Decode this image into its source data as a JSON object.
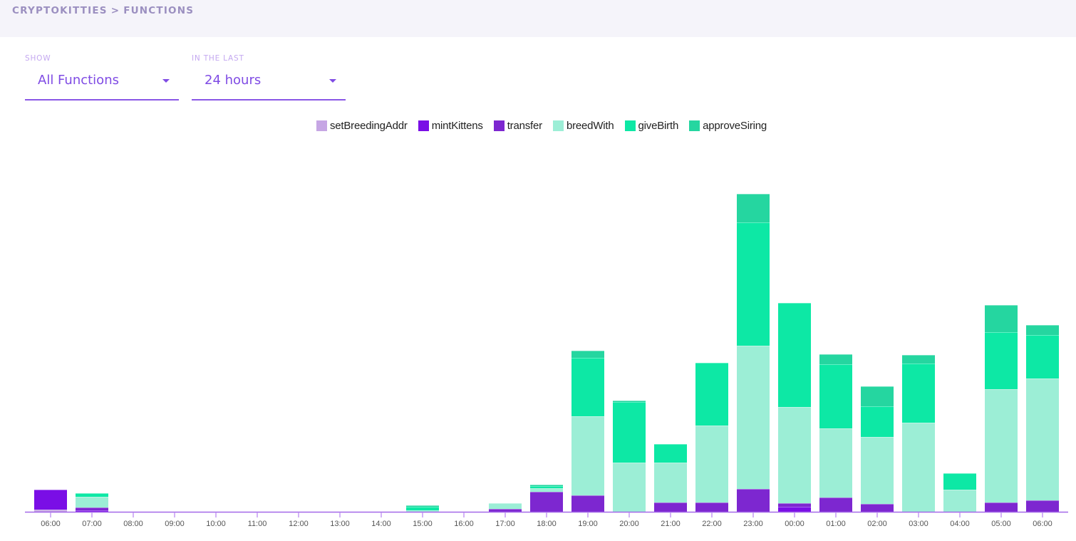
{
  "header": {
    "breadcrumb": {
      "parent": "CRYPTOKITTIES",
      "separator": ">",
      "current": "FUNCTIONS"
    }
  },
  "filters": {
    "show": {
      "label": "SHOW",
      "value": "All Functions",
      "icon": "caret-down-icon"
    },
    "range": {
      "label": "IN THE LAST",
      "value": "24 hours",
      "icon": "caret-down-icon"
    }
  },
  "theme": {
    "accent": "#7f4be4",
    "header_bg": "#f5f4fa",
    "axis_color": "#a468e8",
    "tick_color": "#d3b3f6"
  },
  "chart_data": {
    "type": "bar",
    "stacked": true,
    "title": "",
    "xlabel": "",
    "ylabel": "",
    "y_axis_visible": false,
    "grid": false,
    "legend": "top-center",
    "ylim": [
      0,
      460
    ],
    "categories": [
      "06:00",
      "07:00",
      "08:00",
      "09:00",
      "10:00",
      "11:00",
      "12:00",
      "13:00",
      "14:00",
      "15:00",
      "16:00",
      "17:00",
      "18:00",
      "19:00",
      "20:00",
      "21:00",
      "22:00",
      "23:00",
      "00:00",
      "01:00",
      "02:00",
      "03:00",
      "04:00",
      "05:00",
      "06:00"
    ],
    "series": [
      {
        "name": "setBreedingAddr",
        "color": "#c6a6e4",
        "values": [
          3,
          0,
          0,
          0,
          0,
          0,
          0,
          0,
          0,
          0,
          0,
          0,
          0,
          0,
          0,
          0,
          0,
          0,
          0,
          0,
          0,
          0,
          0,
          0,
          0
        ]
      },
      {
        "name": "mintKittens",
        "color": "#7a0ee6",
        "values": [
          28,
          2,
          0,
          0,
          0,
          0,
          0,
          0,
          0,
          0,
          0,
          0,
          0,
          0,
          0,
          0,
          0,
          0,
          7,
          0,
          0,
          0,
          0,
          0,
          0
        ]
      },
      {
        "name": "transfer",
        "color": "#7d27d0",
        "values": [
          0,
          4,
          0,
          0,
          0,
          0,
          0,
          0,
          0,
          0,
          0,
          4,
          28,
          23,
          0,
          13,
          13,
          32,
          5,
          20,
          11,
          0,
          0,
          13,
          16
        ]
      },
      {
        "name": "breedWith",
        "color": "#9ceed6",
        "values": [
          0,
          15,
          0,
          0,
          0,
          0,
          0,
          0,
          0,
          2,
          0,
          8,
          5,
          111,
          69,
          56,
          108,
          201,
          135,
          97,
          94,
          125,
          31,
          159,
          171
        ]
      },
      {
        "name": "giveBirth",
        "color": "#0de8a5",
        "values": [
          0,
          5,
          0,
          0,
          0,
          0,
          0,
          0,
          0,
          5,
          0,
          0,
          3,
          82,
          85,
          26,
          88,
          173,
          146,
          90,
          43,
          83,
          23,
          80,
          61
        ]
      },
      {
        "name": "approveSiring",
        "color": "#25d6a0",
        "values": [
          0,
          0,
          0,
          0,
          0,
          0,
          0,
          0,
          0,
          2,
          0,
          0,
          2,
          10,
          2,
          0,
          0,
          40,
          0,
          14,
          28,
          12,
          0,
          38,
          14
        ]
      }
    ]
  }
}
